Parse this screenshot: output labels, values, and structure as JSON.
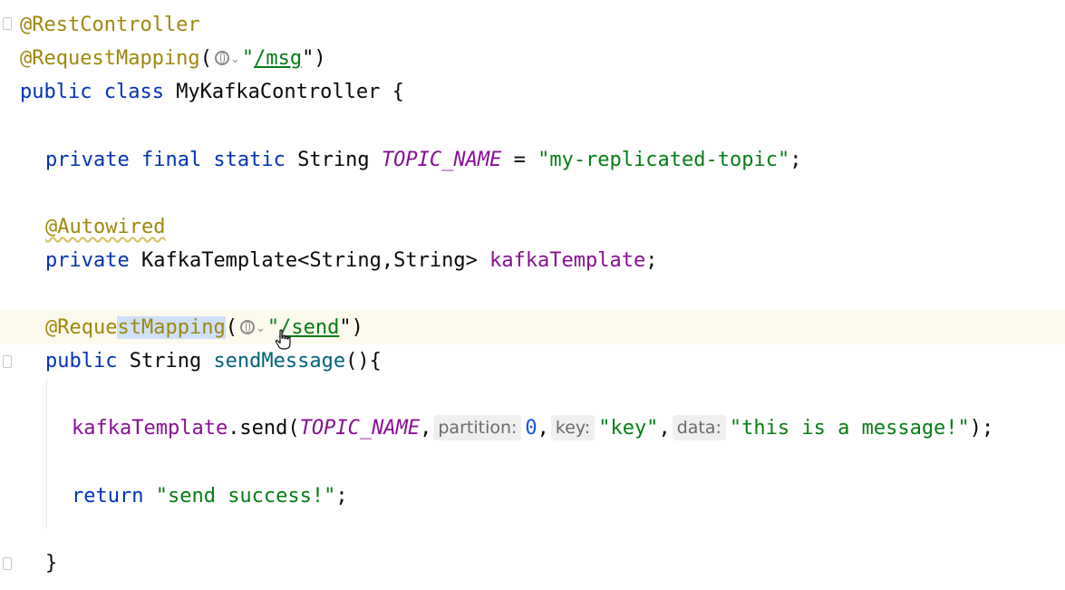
{
  "code": {
    "l1_anno": "@RestController",
    "l2_anno": "@RequestMapping",
    "l2_open": "(",
    "l2_url": "/msg",
    "l2_close": "\")",
    "l3_kw": "public class ",
    "l3_name": "MyKafkaController {",
    "l5_kw": "private final static ",
    "l5_type": "String ",
    "l5_const": "TOPIC_NAME",
    "l5_eq": " = ",
    "l5_str": "\"my-replicated-topic\"",
    "l5_end": ";",
    "l7_anno": "@Autowired",
    "l8_kw": "private ",
    "l8_type": "KafkaTemplate<String,String> ",
    "l8_field": "kafkaTemplate",
    "l8_end": ";",
    "l10_anno_a": "@Reque",
    "l10_anno_b": "stMapping",
    "l10_open": "(",
    "l10_url": "/send",
    "l10_close": "\")",
    "l11_kw": "public ",
    "l11_type": "String ",
    "l11_method": "sendMessage",
    "l11_end": "(){",
    "l13_field": "kafkaTemplate",
    "l13_call": ".send(",
    "l13_const": "TOPIC_NAME",
    "l13_comma1": ",",
    "hint_partition": "partition:",
    "l13_num": "0",
    "l13_comma2": ",",
    "hint_key": "key:",
    "l13_key": "\"key\"",
    "l13_comma3": ",",
    "hint_data": "data:",
    "l13_data": "\"this is a message!\"",
    "l13_end": ");",
    "l15_kw": "return ",
    "l15_str": "\"send success!\"",
    "l15_end": ";",
    "l17_brace": "}"
  },
  "icons": [
    "globe-icon",
    "chevron-down-icon",
    "hand-cursor-icon",
    "fold-marker-icon"
  ]
}
